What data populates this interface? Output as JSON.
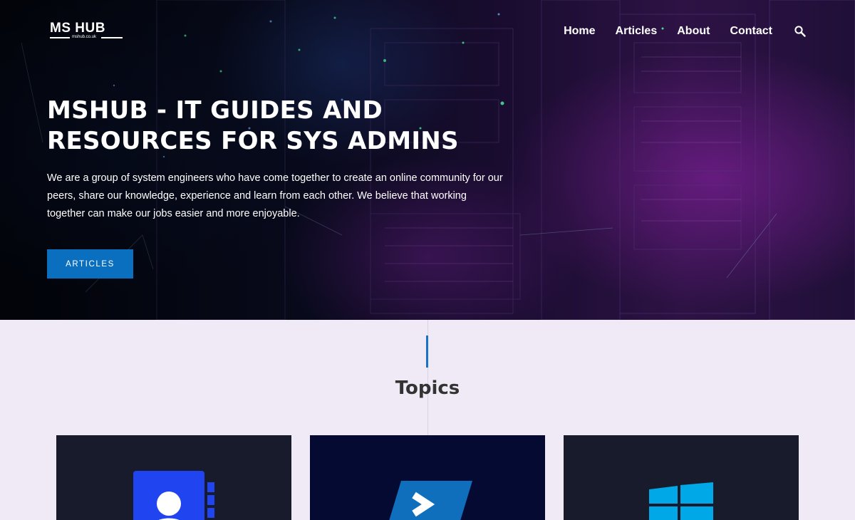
{
  "header": {
    "logo": {
      "title": "MS HUB",
      "subtitle": "mshub.co.uk"
    },
    "nav": [
      {
        "label": "Home"
      },
      {
        "label": "Articles"
      },
      {
        "label": "About"
      },
      {
        "label": "Contact"
      }
    ],
    "search_icon": "search-icon"
  },
  "hero": {
    "title": "MSHUB - IT GUIDES AND RESOURCES FOR SYS ADMINS",
    "description": "We are a group of system engineers who have come together to create an online community for our peers, share our knowledge, experience and learn from each other. We believe that working together can make our jobs easier and more enjoyable.",
    "button_label": "ARTICLES"
  },
  "topics": {
    "title": "Topics",
    "cards": [
      {
        "icon": "contact-book-icon"
      },
      {
        "icon": "powershell-icon"
      },
      {
        "icon": "windows-icon"
      }
    ]
  },
  "colors": {
    "accent": "#0a6fbe",
    "page_bg": "#efeaf6",
    "card_bg": "#181b2b",
    "card_bg_alt": "#050a33",
    "contact_icon": "#1f44f0",
    "powershell_icon": "#0f6fbd",
    "windows_icon": "#00a8e8"
  }
}
